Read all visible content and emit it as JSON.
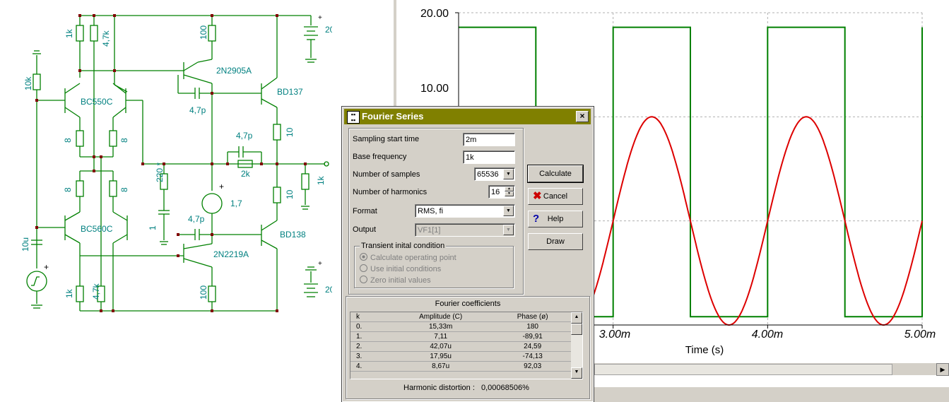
{
  "schematic": {
    "labels": {
      "r_1k_top": "1k",
      "r_4k7_top": "4,7k",
      "r_100_top": "100",
      "batt_top": "20",
      "plus_top": "+",
      "q_2n2905a": "2N2905A",
      "r_10k": "10k",
      "q_bc550c": "BC550C",
      "q_bd137": "BD137",
      "c_4p7_top": "4,7p",
      "r_8_a": "8",
      "r_8_b": "8",
      "r_10_top": "10",
      "c_4p7_mid": "4,7p",
      "r_2k": "2k",
      "r_220": "220 *",
      "r_1k_out": "1k",
      "r_8_c": "8",
      "r_8_d": "8",
      "v_17": "1,7",
      "plus_mid": "+",
      "r_10_bot": "10",
      "c_1": "1",
      "c_4p7_bot": "4,7p",
      "q_bc560c": "BC560C",
      "q_bd138": "BD138",
      "c_10u": "10u",
      "q_2n2219a": "2N2219A",
      "plus_src": "+",
      "r_1k_bot": "1k",
      "r_4k7_bot": "4,7k",
      "r_100_bot": "100",
      "batt_bot": "20",
      "plus_bot": "+"
    }
  },
  "chart_data": {
    "type": "line",
    "xlabel": "Time (s)",
    "x_ticks": [
      "3.00m",
      "4.00m",
      "5.00m"
    ],
    "y_ticks": [
      "20.00",
      "10.00"
    ],
    "xlim": [
      2.0,
      5.0
    ],
    "ylim": [
      -10,
      20
    ],
    "grid": true,
    "series": [
      {
        "color": "#008000",
        "kind": "square",
        "high": 18.6,
        "low": -9.2,
        "period_ms": 1.0,
        "rise_ms": 0.5
      },
      {
        "color": "#dd0000",
        "kind": "sine",
        "amplitude": 10,
        "period_ms": 1.0,
        "phase_ms": 0.0
      }
    ]
  },
  "dialog": {
    "title": "Fourier Series",
    "close": "×",
    "sampling_label": "Sampling start time",
    "sampling_value": "2m",
    "basefreq_label": "Base frequency",
    "basefreq_value": "1k",
    "samples_label": "Number of samples",
    "samples_value": "65536",
    "harmonics_label": "Number of harmonics",
    "harmonics_value": "16",
    "format_label": "Format",
    "format_value": "RMS, fi",
    "output_label": "Output",
    "output_value": "VF1[1]",
    "transient_label": "Transient inital condition",
    "radio_calc": "Calculate operating point",
    "radio_use": "Use initial conditions",
    "radio_zero": "Zero initial values",
    "calculate": "Calculate",
    "cancel": "Cancel",
    "help": "Help",
    "draw": "Draw",
    "coeff_title": "Fourier coefficients",
    "columns": [
      "k",
      "Amplitude (C)",
      "Phase (ø)"
    ],
    "rows": [
      [
        "0.",
        "15,33m",
        "180"
      ],
      [
        "1.",
        "7,11",
        "-89,91"
      ],
      [
        "2.",
        "42,07u",
        "24,59"
      ],
      [
        "3.",
        "17,95u",
        "-74,13"
      ],
      [
        "4.",
        "8,67u",
        "92,03"
      ]
    ],
    "distortion_label": "Harmonic distortion :",
    "distortion_value": "0,00068506%"
  }
}
